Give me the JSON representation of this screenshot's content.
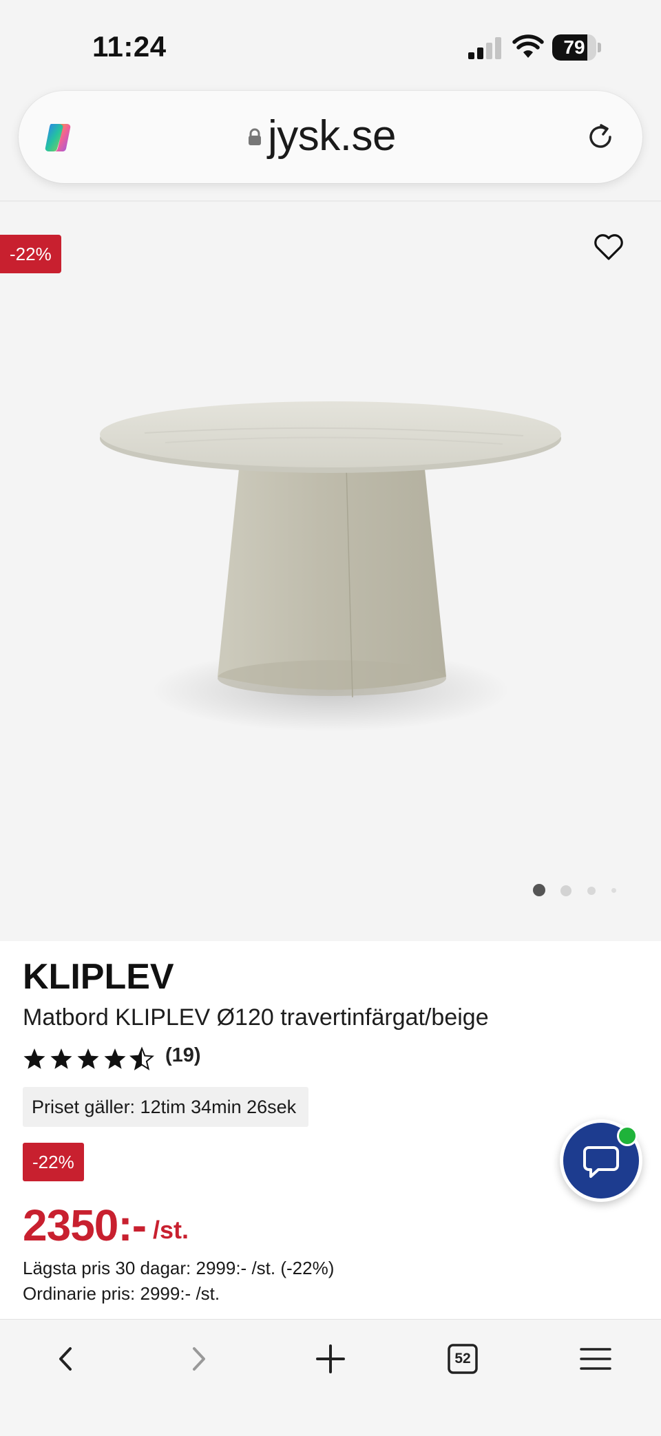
{
  "status_bar": {
    "time": "11:24",
    "battery_level": "79"
  },
  "browser": {
    "url": "jysk.se",
    "tabs_count": "52"
  },
  "gallery": {
    "discount_badge": "-22%",
    "image_index": 1,
    "image_count": 4
  },
  "product": {
    "brand": "KLIPLEV",
    "name": "Matbord KLIPLEV Ø120 travertinfärgat/beige",
    "rating": 4.5,
    "review_count": "(19)",
    "timer_text": "Priset gäller: 12tim 34min 26sek",
    "discount_badge": "-22%",
    "price": "2350:-",
    "price_unit": "/st.",
    "lowest_price": "Lägsta pris 30 dagar: 2999:- /st. (-22%)",
    "ordinary_price": "Ordinarie pris: 2999:- /st."
  },
  "colors": {
    "accent_red": "#c8202f",
    "chat_blue": "#1d3c8f",
    "online_green": "#1fb33a"
  }
}
